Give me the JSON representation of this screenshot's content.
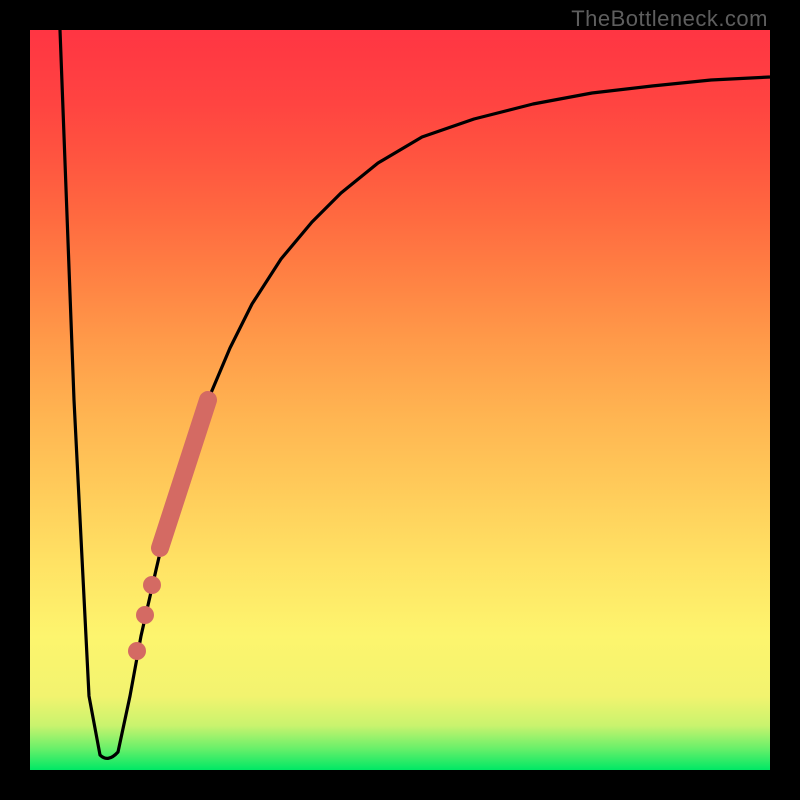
{
  "attribution": "TheBottleneck.com",
  "colors": {
    "frame": "#000000",
    "curve": "#000000",
    "marker": "#d46a63",
    "gradient_top": "#ff3543",
    "gradient_bottom": "#00e865"
  },
  "chart_data": {
    "type": "line",
    "title": "",
    "xlabel": "",
    "ylabel": "",
    "xlim": [
      0,
      100
    ],
    "ylim": [
      0,
      100
    ],
    "series": [
      {
        "name": "bottleneck-curve",
        "x": [
          4,
          6,
          8,
          9.5,
          11,
          12,
          13.5,
          15,
          17,
          19,
          21,
          24,
          27,
          30,
          34,
          38,
          42,
          47,
          53,
          60,
          68,
          76,
          84,
          92,
          100
        ],
        "y": [
          100,
          50,
          10,
          2,
          2,
          4,
          10,
          18,
          27,
          35,
          42,
          50,
          57,
          63,
          69,
          74,
          78,
          82,
          85.5,
          88,
          90,
          91.5,
          92.5,
          93.2,
          93.7
        ]
      }
    ],
    "highlight_segment": {
      "name": "highlight-band",
      "kind": "thick-line",
      "x": [
        17.5,
        24
      ],
      "y": [
        30,
        50
      ]
    },
    "highlight_markers": [
      {
        "x": 16.5,
        "y": 25
      },
      {
        "x": 15.5,
        "y": 21
      },
      {
        "x": 14.5,
        "y": 16
      }
    ]
  }
}
